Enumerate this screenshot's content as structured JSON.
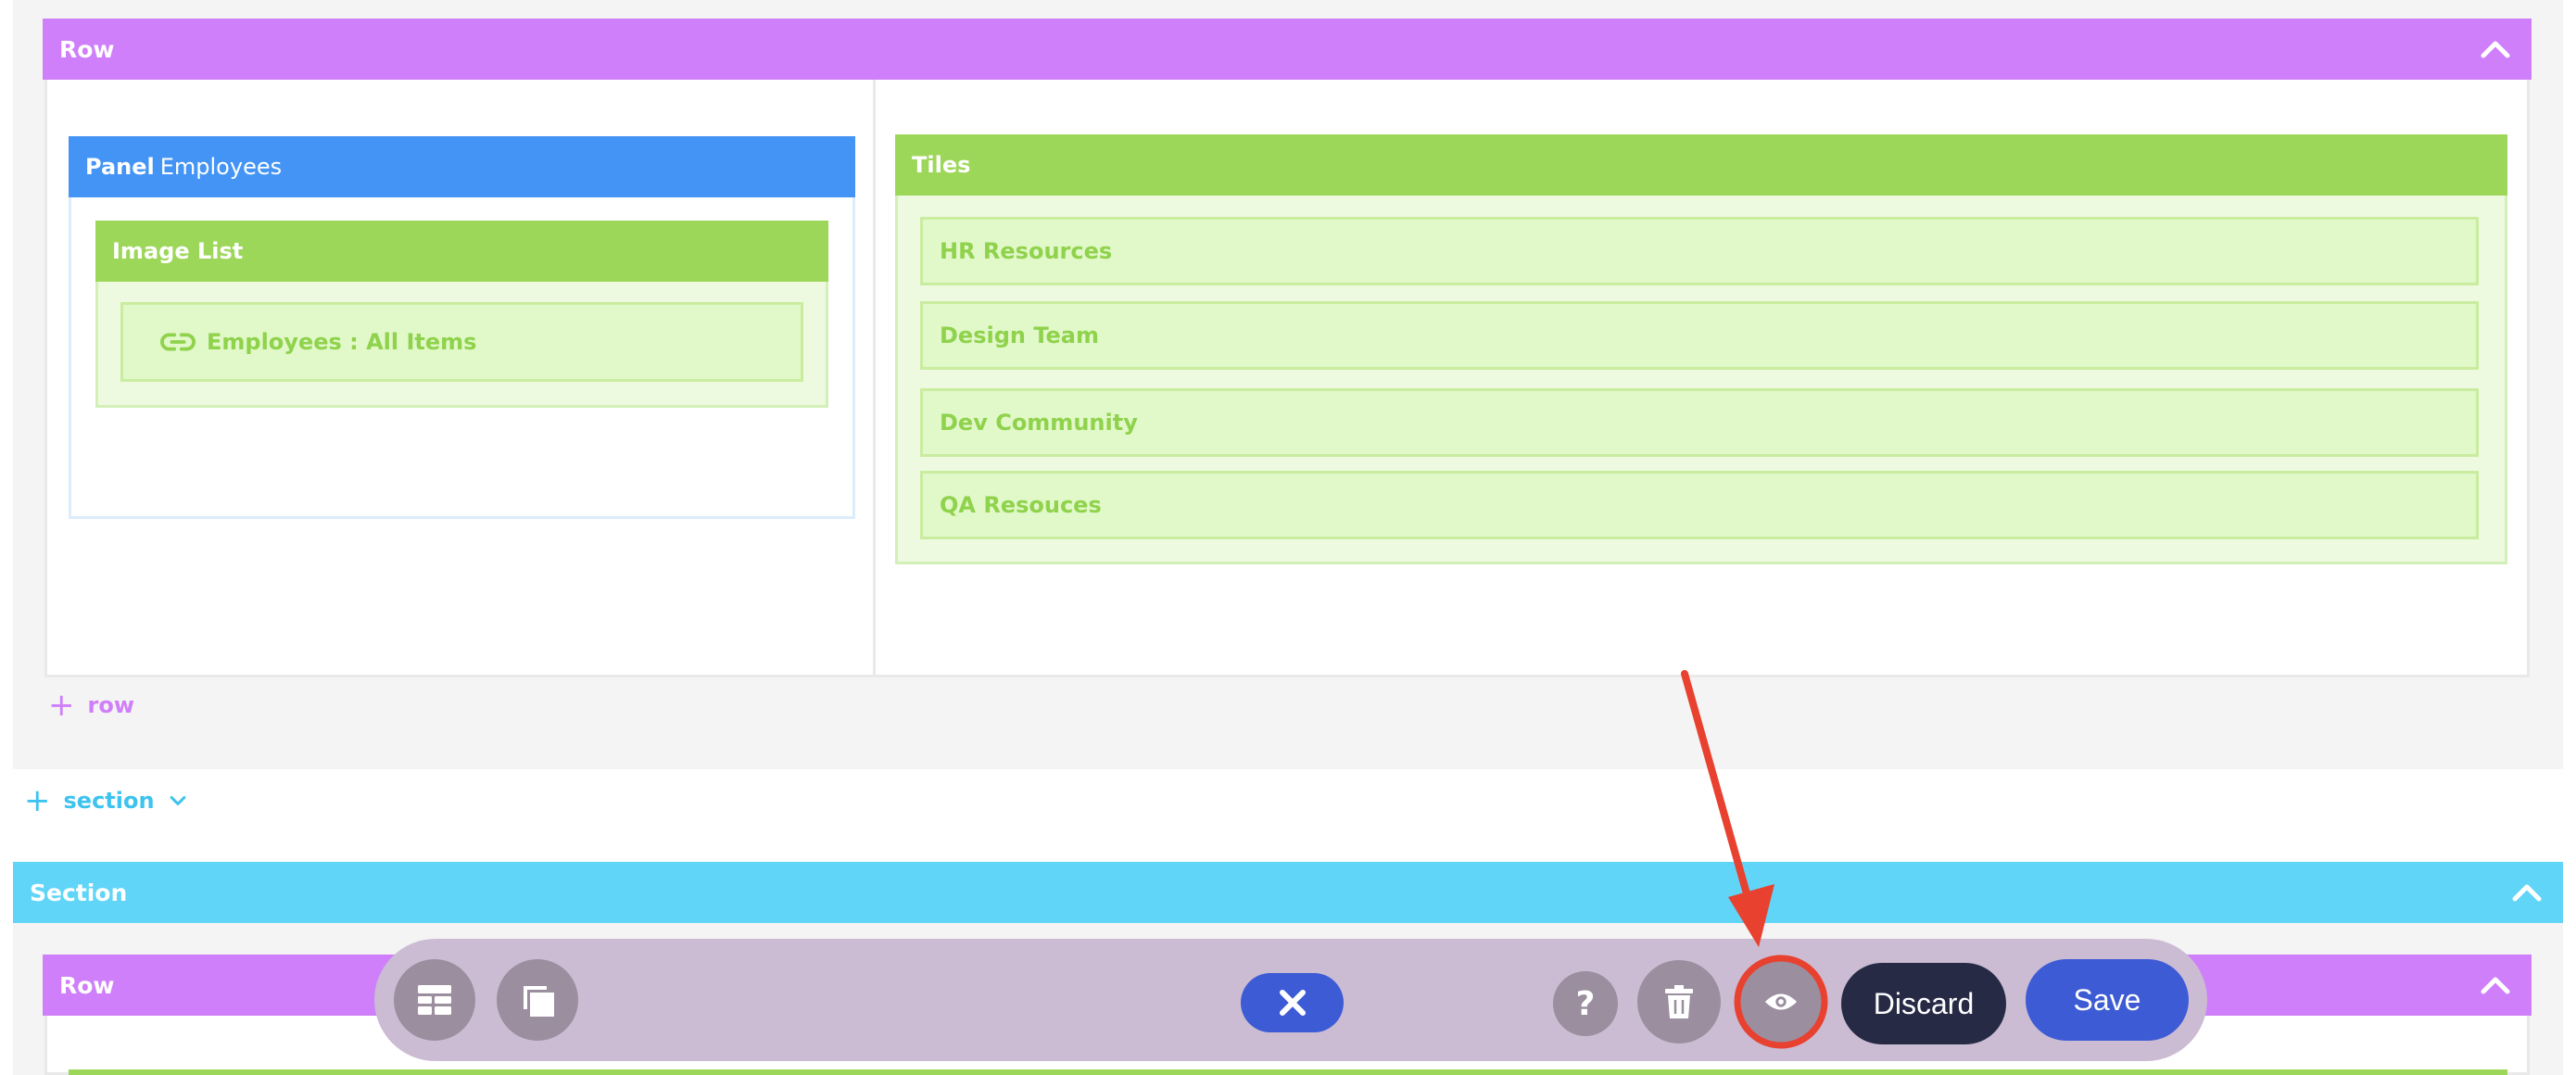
{
  "section1": {
    "row": {
      "title": "Row",
      "panel": {
        "label": "Panel",
        "name": "Employees",
        "image_list": {
          "title": "Image List",
          "item": "Employees : All Items"
        }
      },
      "tiles": {
        "title": "Tiles",
        "items": [
          "HR Resources",
          "Design Team",
          "Dev Community",
          "QA Resouces"
        ]
      }
    },
    "add_row_label": "row"
  },
  "add_section_label": "section",
  "section2": {
    "title": "Section",
    "row_title": "Row"
  },
  "toolbar": {
    "discard_label": "Discard",
    "save_label": "Save"
  },
  "colors": {
    "row_bar": "#cf7ff9",
    "section_bar": "#61d5f8",
    "panel_bar": "#4494f5",
    "green_bar": "#9dd75a",
    "primary": "#3d5bd4",
    "annotation": "#e8412f"
  },
  "icons": [
    "chevron-up-icon",
    "link-icon",
    "plus-icon",
    "chevron-down-icon",
    "layout-icon",
    "duplicate-icon",
    "close-icon",
    "help-icon",
    "trash-icon",
    "eye-icon"
  ]
}
